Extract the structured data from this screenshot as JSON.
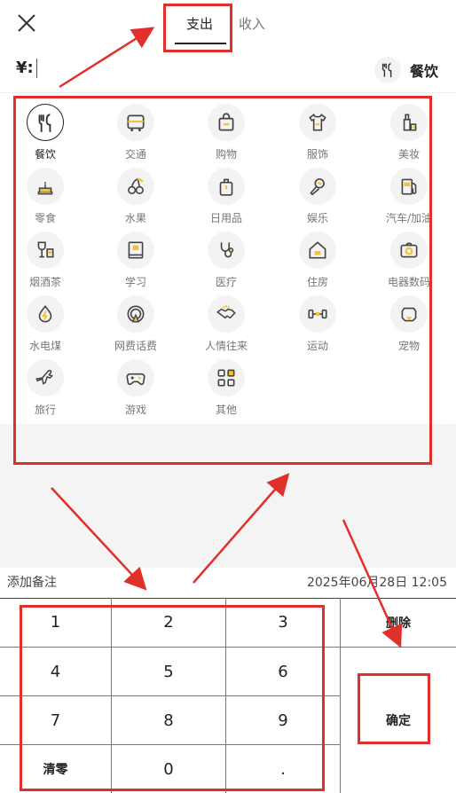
{
  "header": {
    "tab_expense": "支出",
    "tab_income": "收入",
    "amount_prefix": "¥:",
    "selected_category": "餐饮"
  },
  "categories": [
    {
      "label": "餐饮",
      "icon": "fork-knife-icon",
      "selected": true
    },
    {
      "label": "交通",
      "icon": "bus-icon"
    },
    {
      "label": "购物",
      "icon": "shopping-bag-icon"
    },
    {
      "label": "服饰",
      "icon": "tshirt-icon"
    },
    {
      "label": "美妆",
      "icon": "cosmetics-icon"
    },
    {
      "label": "零食",
      "icon": "cake-icon"
    },
    {
      "label": "水果",
      "icon": "cherry-icon"
    },
    {
      "label": "日用品",
      "icon": "daily-goods-icon"
    },
    {
      "label": "娱乐",
      "icon": "microphone-icon"
    },
    {
      "label": "汽车/加油",
      "icon": "fuel-pump-icon"
    },
    {
      "label": "烟酒茶",
      "icon": "wine-icon"
    },
    {
      "label": "学习",
      "icon": "book-icon"
    },
    {
      "label": "医疗",
      "icon": "stethoscope-icon"
    },
    {
      "label": "住房",
      "icon": "house-icon"
    },
    {
      "label": "电器数码",
      "icon": "camera-icon"
    },
    {
      "label": "水电煤",
      "icon": "drop-icon"
    },
    {
      "label": "网费话费",
      "icon": "signal-icon"
    },
    {
      "label": "人情往来",
      "icon": "handshake-icon"
    },
    {
      "label": "运动",
      "icon": "dumbbell-icon"
    },
    {
      "label": "宠物",
      "icon": "pet-icon"
    },
    {
      "label": "旅行",
      "icon": "airplane-icon"
    },
    {
      "label": "游戏",
      "icon": "gamepad-icon"
    },
    {
      "label": "其他",
      "icon": "other-grid-icon"
    }
  ],
  "note": {
    "placeholder": "添加备注",
    "datetime": "2025年06月28日 12:05"
  },
  "keypad": {
    "keys": [
      "1",
      "2",
      "3",
      "4",
      "5",
      "6",
      "7",
      "8",
      "9",
      "清零",
      "0",
      "."
    ],
    "delete_label": "删除",
    "confirm_label": "确定"
  },
  "colors": {
    "accent": "#f2c230",
    "annotation": "#e0302a",
    "icon_bg": "#f3f3f3"
  }
}
